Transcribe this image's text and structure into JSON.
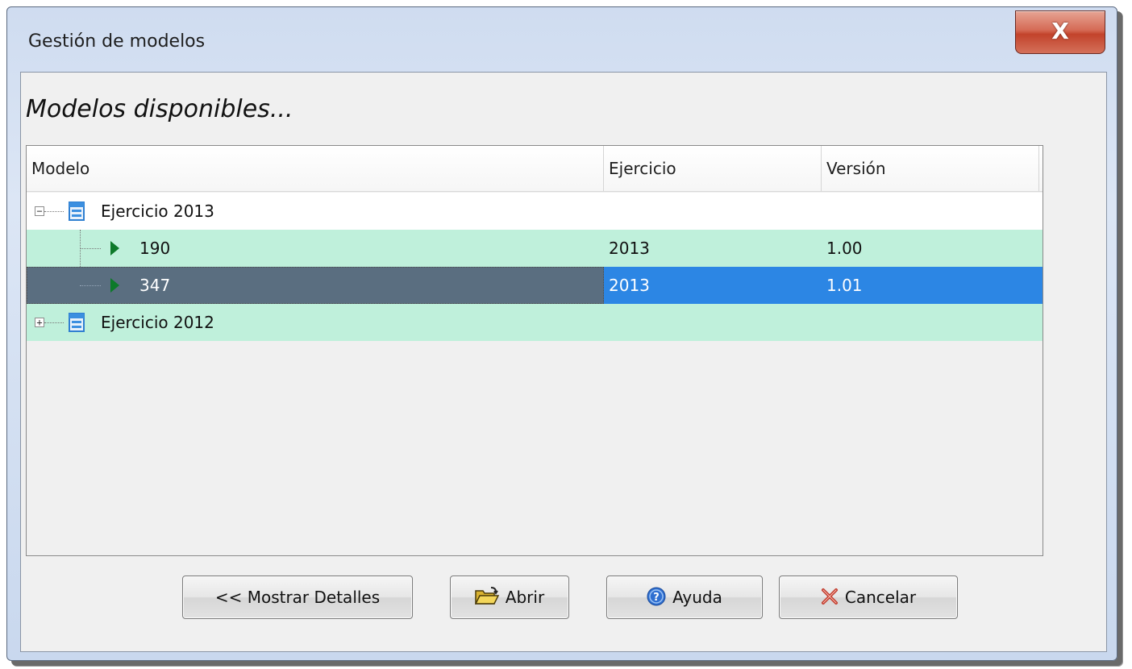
{
  "window": {
    "title": "Gestión de modelos",
    "close_glyph": "X"
  },
  "heading": "Modelos disponibles...",
  "columns": [
    "Modelo",
    "Ejercicio",
    "Versión"
  ],
  "tree": {
    "groups": [
      {
        "label": "Ejercicio 2013",
        "expanded": true,
        "expander": "−",
        "children": [
          {
            "modelo": "190",
            "ejercicio": "2013",
            "version": "1.00",
            "selected": false
          },
          {
            "modelo": "347",
            "ejercicio": "2013",
            "version": "1.01",
            "selected": true
          }
        ]
      },
      {
        "label": "Ejercicio 2012",
        "expanded": false,
        "expander": "+",
        "children": []
      }
    ]
  },
  "buttons": {
    "details": "<< Mostrar Detalles",
    "open": "Abrir",
    "help": "Ayuda",
    "cancel": "Cancelar"
  },
  "icons": {
    "group": "form-document-icon",
    "item": "play-arrow-icon",
    "open": "open-folder-icon",
    "help": "help-icon",
    "cancel": "cancel-x-icon"
  },
  "colors": {
    "selection": "#2c86e4",
    "alt_row": "#bff0db",
    "close_button": "#c2432b"
  }
}
